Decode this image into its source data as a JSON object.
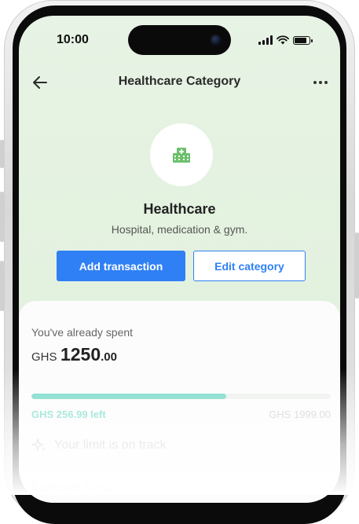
{
  "status_bar": {
    "time": "10:00"
  },
  "header": {
    "title": "Healthcare Category"
  },
  "category": {
    "name": "Healthcare",
    "description": "Hospital, medication & gym.",
    "icon": "hospital-icon",
    "icon_color": "#6cc06a"
  },
  "actions": {
    "add_label": "Add transaction",
    "edit_label": "Edit category"
  },
  "spending": {
    "spent_label": "You've already spent",
    "currency": "GHS",
    "amount_whole": "1250",
    "amount_decimal": ".00",
    "progress_fraction": 0.65,
    "left_text": "GHS 256.99 left",
    "limit_text": "GHS 1999.00",
    "status_text": "Your limit is on track"
  },
  "section": {
    "trend_title": "Expenses Trend"
  },
  "colors": {
    "primary": "#2f80f5",
    "progress": "#6fd8c4",
    "background": "#e7f3e4"
  }
}
